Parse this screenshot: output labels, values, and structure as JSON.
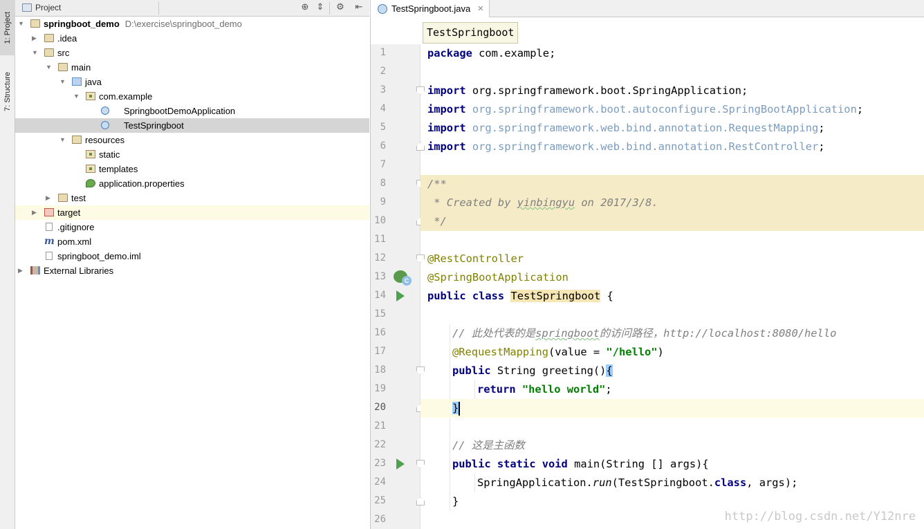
{
  "toolstrip": {
    "project_tab": "1: Project",
    "structure_tab": "7: Structure"
  },
  "project_panel": {
    "title": "Project",
    "tree": [
      {
        "label": "springboot_demo",
        "path": "D:\\exercise\\springboot_demo",
        "icon": "module-folder-icon"
      },
      {
        "label": ".idea",
        "icon": "folder-icon"
      },
      {
        "label": "src",
        "icon": "folder-icon"
      },
      {
        "label": "main",
        "icon": "folder-icon"
      },
      {
        "label": "java",
        "icon": "source-folder-icon"
      },
      {
        "label": "com.example",
        "icon": "package-icon"
      },
      {
        "label": "SpringbootDemoApplication",
        "icon": "spring-class-icon"
      },
      {
        "label": "TestSpringboot",
        "icon": "spring-class-icon"
      },
      {
        "label": "resources",
        "icon": "resources-folder-icon"
      },
      {
        "label": "static",
        "icon": "package-icon"
      },
      {
        "label": "templates",
        "icon": "package-icon"
      },
      {
        "label": "application.properties",
        "icon": "spring-properties-icon"
      },
      {
        "label": "test",
        "icon": "folder-icon"
      },
      {
        "label": "target",
        "icon": "excluded-folder-icon"
      },
      {
        "label": ".gitignore",
        "icon": "file-icon"
      },
      {
        "label": "pom.xml",
        "icon": "maven-icon"
      },
      {
        "label": "springboot_demo.iml",
        "icon": "file-icon"
      },
      {
        "label": "External Libraries",
        "icon": "libraries-icon"
      }
    ]
  },
  "editor": {
    "tab_label": "TestSpringboot.java",
    "breadcrumb_tooltip": "TestSpringboot",
    "line_numbers": [
      "1",
      "2",
      "3",
      "4",
      "5",
      "6",
      "7",
      "8",
      "9",
      "10",
      "11",
      "12",
      "13",
      "14",
      "15",
      "16",
      "17",
      "18",
      "19",
      "20",
      "21",
      "22",
      "23",
      "24",
      "25",
      "26"
    ],
    "code": {
      "l1_kw": "package",
      "l1_rest": " com.example;",
      "l3_kw": "import",
      "l3_rest": " org.springframework.boot.SpringApplication;",
      "l4_kw": "import",
      "l4_rest": " org.springframework.boot.autoconfigure.SpringBootApplication",
      "l4_semi": ";",
      "l5_kw": "import",
      "l5_rest": " org.springframework.web.bind.annotation.RequestMapping",
      "l5_semi": ";",
      "l6_kw": "import",
      "l6_rest": " org.springframework.web.bind.annotation.RestController",
      "l6_semi": ";",
      "l8": "/**",
      "l9_a": " * Created by ",
      "l9_b": "yinbingyu",
      "l9_c": " on 2017/3/8.",
      "l10": " */",
      "l12": "@RestController",
      "l13": "@SpringBootApplication",
      "l14_kw": "public class",
      "l14_name": "TestSpringboot",
      "l14_rest": " {",
      "l16_a": "// 此处代表的是",
      "l16_b": "springboot",
      "l16_c": "的访问路径，http://localhost:8080/hello",
      "l17_ann": "@RequestMapping",
      "l17_a": "(value = ",
      "l17_str": "\"/hello\"",
      "l17_b": ")",
      "l18_kw": "public",
      "l18_rest": " String greeting()",
      "l18_brace": "{",
      "l19_kw": "return",
      "l19_str": "\"hello world\"",
      "l19_semi": ";",
      "l20": "}",
      "l22": "// 这是主函数",
      "l23_kw": "public static void",
      "l23_rest": " main(String [] args){",
      "l24_a": "SpringApplication.",
      "l24_run": "run",
      "l24_b": "(TestSpringboot.",
      "l24_kw": "class",
      "l24_c": ", args);",
      "l25": "}"
    }
  },
  "watermark": "http://blog.csdn.net/Y12nre"
}
